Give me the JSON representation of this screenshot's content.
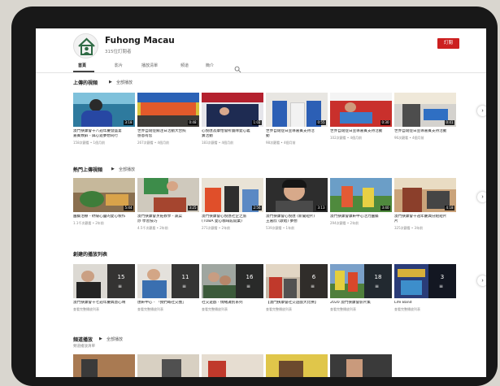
{
  "channel": {
    "name": "Fuhong Macau",
    "subtitle": "315位訂閱者",
    "subscribe_label": "訂閱"
  },
  "tabs": [
    {
      "label": "首頁",
      "active": true
    },
    {
      "label": "影片",
      "active": false
    },
    {
      "label": "播放清單",
      "active": false
    },
    {
      "label": "頻道",
      "active": false
    },
    {
      "label": "簡介",
      "active": false
    }
  ],
  "icons": {
    "search": "search-icon",
    "play": "play-icon",
    "next": "chevron-right-icon",
    "playlist": "playlist-icon"
  },
  "colors": {
    "subscribe": "#cc1f1f",
    "duration_bg": "#000000"
  },
  "sections": {
    "uploads": {
      "title": "上傳的視頻",
      "play_all": "全部播放",
      "videos": [
        {
          "title1": "澳門扶康會十八週年慶暨盛宴",
          "title2": "嘉賓致辭 - 與心遊夢想同行",
          "meta": "158次觀看 • 1個月前",
          "duration": "3:18"
        },
        {
          "title1": "世界自閉症關注日活動大合照",
          "title2": "感恩有您",
          "meta": "267次觀看 • 4個月前",
          "duration": "0:48"
        },
        {
          "title1": "心悅匯及康怡會所團隊愛心義",
          "title2": "賣活動",
          "meta": "183次觀看 • 4個月前",
          "duration": "1:02"
        },
        {
          "title1": "世界自閉症日宣導嘉賓支持活",
          "title2": "動",
          "meta": "98次觀看 • 4個月前",
          "duration": "0:55"
        },
        {
          "title1": "世界自閉症日宣導嘉賓支持活動",
          "title2": "",
          "meta": "102次觀看 • 4個月前",
          "duration": "0:30"
        },
        {
          "title1": "世界自閉症日宣導嘉賓支持活動",
          "title2": "",
          "meta": "96次觀看 • 4個月前",
          "duration": "0:41"
        }
      ]
    },
    "popular": {
      "title": "熱門上傳視頻",
      "play_all": "全部播放",
      "videos": [
        {
          "title1": "園藝治療 - 紓緩心靈的愛心製作",
          "title2": "",
          "meta": "1.1千次觀看 • 2年前",
          "duration": "5:44"
        },
        {
          "title1": "澳門扶康會烹飪教學 - 蔬菜",
          "title2": "炒 學習技巧",
          "meta": "4.5千次觀看 • 2年前",
          "duration": "3:25"
        },
        {
          "title1": "澳門扶康會心悅匯社企之旅",
          "title2": "(TOBA 愛心咖啡館開業)",
          "meta": "271次觀看 • 2年前",
          "duration": "2:56"
        },
        {
          "title1": "澳門扶康會心悅匯 (新聞短片)",
          "title2": "王嘉欣 (歌唱) 夢想",
          "meta": "539次觀看 • 1年前",
          "duration": "3:13"
        },
        {
          "title1": "澳門扶康會康軒中心活力園藝",
          "title2": "",
          "meta": "294次觀看 • 2年前",
          "duration": "3:40"
        },
        {
          "title1": "澳門扶康會十週年慶典分組短片",
          "title2": "片",
          "meta": "325次觀看 • 3年前",
          "duration": "4:18"
        }
      ]
    },
    "playlists": {
      "title": "創建的播放列表",
      "items": [
        {
          "title1": "澳門扶康會十七週年慶典暨心晴",
          "title2": "",
          "meta": "查看完整播放列表",
          "count": "15"
        },
        {
          "title1": "匯軒中心 - 「我們嘅社交圈」",
          "title2": "",
          "meta": "查看完整播放列表",
          "count": "11"
        },
        {
          "title1": "社交遊戲 - 情緒識別系列",
          "title2": "",
          "meta": "查看完整播放列表",
          "count": "16"
        },
        {
          "title1": "【澳門扶康會社交遊戲大比拼】",
          "title2": "",
          "meta": "查看完整播放列表",
          "count": "6"
        },
        {
          "title1": "2020 澳門扶康會影片集",
          "title2": "",
          "meta": "查看完整播放列表",
          "count": "18"
        },
        {
          "title1": "Life Band",
          "title2": "",
          "meta": "查看完整播放列表",
          "count": "3"
        }
      ]
    },
    "channel_feed": {
      "title": "頻道播放",
      "play_all": "全部播放",
      "description": "頻道播放清單"
    }
  }
}
